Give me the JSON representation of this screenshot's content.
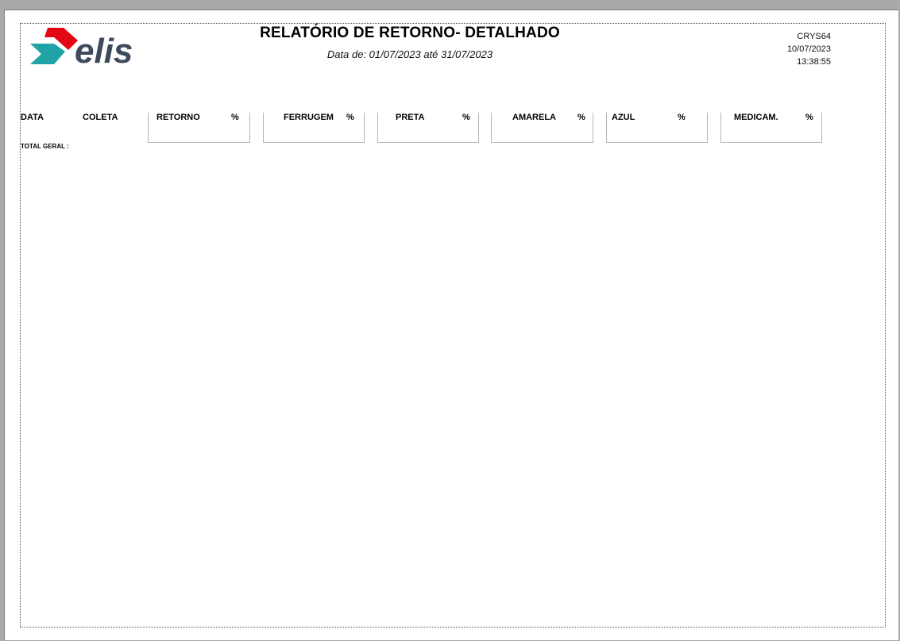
{
  "report": {
    "title": "RELATÓRIO DE RETORNO- DETALHADO",
    "subtitle": "Data de: 01/07/2023 até 31/07/2023",
    "code": "CRYS64",
    "date": "10/07/2023",
    "time": "13:38:55",
    "logo_text": "elis"
  },
  "columns": {
    "data": "DATA",
    "coleta": "COLETA",
    "groups": [
      {
        "label": "RETORNO",
        "pct": "%"
      },
      {
        "label": "FERRUGEM",
        "pct": "%"
      },
      {
        "label": "PRETA",
        "pct": "%"
      },
      {
        "label": "AMARELA",
        "pct": "%"
      },
      {
        "label": "AZUL",
        "pct": "%"
      },
      {
        "label": "MEDICAM.",
        "pct": "%"
      }
    ]
  },
  "totals": {
    "label": "TOTAL GERAL :"
  },
  "colors": {
    "logo_red": "#e30613",
    "logo_teal": "#1fa3a6",
    "logo_text": "#3d4a5c"
  }
}
